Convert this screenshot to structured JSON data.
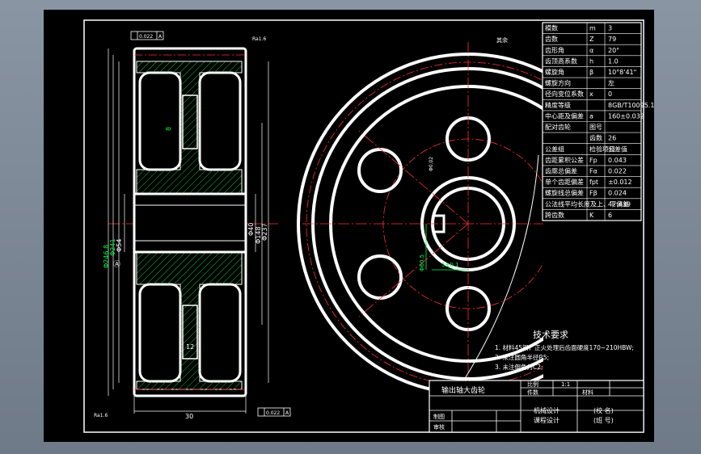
{
  "tolerance_top": {
    "value": "0.022",
    "datum": "A"
  },
  "tolerance_bottom": {
    "value": "0.022",
    "datum": "A"
  },
  "ra_top_left": "Ra1.6",
  "ra_top_right": "Ra1.6",
  "ra_rest": "其余",
  "dims": {
    "width": "30",
    "d1": "Φ246.8",
    "d2": "Φ241",
    "d3": "Φ54",
    "d4": "Φ40",
    "d5": "Φ148",
    "d6": "Φ237",
    "hub": "12",
    "keyway": "5±0.1",
    "bore_h": "Φ60.5",
    "hole": "Φ0.02",
    "rib": "8"
  },
  "params": [
    {
      "name": "模数",
      "sym": "m",
      "val": "3"
    },
    {
      "name": "齿数",
      "sym": "Z",
      "val": "79"
    },
    {
      "name": "齿形角",
      "sym": "α",
      "val": "20°"
    },
    {
      "name": "齿顶高系数",
      "sym": "h",
      "val": "1.0"
    },
    {
      "name": "螺旋角",
      "sym": "β",
      "val": "10°8'41\""
    },
    {
      "name": "螺旋方向",
      "sym": "",
      "val": "左"
    },
    {
      "name": "径向变位系数",
      "sym": "x",
      "val": "0"
    },
    {
      "name": "精度等级",
      "sym": "",
      "val": "8GB/T10095.1-2001"
    },
    {
      "name": "中心距及偏差",
      "sym": "a",
      "val": "160±0.032"
    },
    {
      "name": "配对齿轮",
      "sym": "图号",
      "val": ""
    },
    {
      "name": "",
      "sym": "齿数",
      "val": "26"
    },
    {
      "name": "公差组",
      "sym": "检验项目",
      "val": "公差值"
    },
    {
      "name": "齿距累积公差",
      "sym": "Fp",
      "val": "0.043"
    },
    {
      "name": "齿廓总偏差",
      "sym": "Fα",
      "val": "0.022"
    },
    {
      "name": "单个齿距偏差",
      "sym": "fpt",
      "val": "±0.012"
    },
    {
      "name": "螺旋线总偏差",
      "sym": "Fβ",
      "val": "0.024"
    },
    {
      "name": "公法线平均长度及上、下偏差",
      "sym": "",
      "val": "42.439"
    },
    {
      "name": "跨齿数",
      "sym": "K",
      "val": "6"
    }
  ],
  "tech_title": "技术要求",
  "tech_lines": [
    "1. 材料45钢，正火处理后齿面硬度170~210HBW;",
    "2. 未注圆角半径R5;",
    "3. 未注倒角为C2;"
  ],
  "title_block": {
    "name": "输出轴大齿轮",
    "ratio_label": "比例",
    "ratio": "1:1",
    "qty_label": "件数",
    "mat_label": "材料",
    "draw_label": "制图",
    "check_label": "审核",
    "course1": "机械设计",
    "course2": "课程设计",
    "school": "(校 名)",
    "class": "(班 号)"
  }
}
